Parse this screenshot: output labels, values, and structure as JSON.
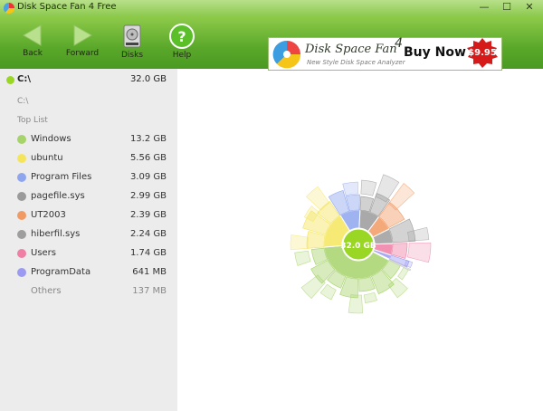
{
  "window": {
    "title": "Disk Space Fan 4 Free",
    "controls": {
      "minimize": "—",
      "maximize": "☐",
      "close": "✕"
    }
  },
  "toolbar": {
    "back_label": "Back",
    "forward_label": "Forward",
    "disks_label": "Disks",
    "help_label": "Help"
  },
  "ad": {
    "product": "Disk Space Fan",
    "version": "4",
    "tagline": "New Style Disk Space Analyzer",
    "cta": "Buy Now",
    "price": "$9.95"
  },
  "sidebar": {
    "drive": {
      "name": "C:\\",
      "size": "32.0 GB"
    },
    "path": "C:\\",
    "top_list_label": "Top List",
    "items": [
      {
        "name": "Windows",
        "size": "13.2 GB",
        "color": "#a6d36a"
      },
      {
        "name": "ubuntu",
        "size": "5.56 GB",
        "color": "#f4e55c"
      },
      {
        "name": "Program Files",
        "size": "3.09 GB",
        "color": "#8fa6ef"
      },
      {
        "name": "pagefile.sys",
        "size": "2.99 GB",
        "color": "#9a9a9a"
      },
      {
        "name": "UT2003",
        "size": "2.39 GB",
        "color": "#f29a63"
      },
      {
        "name": "hiberfil.sys",
        "size": "2.24 GB",
        "color": "#9e9e9e"
      },
      {
        "name": "Users",
        "size": "1.74 GB",
        "color": "#ef7fa4"
      },
      {
        "name": "ProgramData",
        "size": "641 MB",
        "color": "#9a9af2"
      }
    ],
    "others": {
      "name": "Others",
      "size": "137 MB"
    }
  },
  "chart_data": {
    "type": "pie",
    "center_label": "32.0 GB",
    "total_gb": 32.0,
    "slices": [
      {
        "name": "Windows",
        "value": 13.2,
        "color": "#a6d36a"
      },
      {
        "name": "ubuntu",
        "value": 5.56,
        "color": "#f4e55c"
      },
      {
        "name": "Program Files",
        "value": 3.09,
        "color": "#8fa6ef"
      },
      {
        "name": "pagefile.sys",
        "value": 2.99,
        "color": "#9a9a9a"
      },
      {
        "name": "UT2003",
        "value": 2.39,
        "color": "#f29a63"
      },
      {
        "name": "hiberfil.sys",
        "value": 2.24,
        "color": "#9e9e9e"
      },
      {
        "name": "Users",
        "value": 1.74,
        "color": "#ef7fa4"
      },
      {
        "name": "ProgramData",
        "value": 0.641,
        "color": "#9a9af2"
      },
      {
        "name": "Others",
        "value": 0.137,
        "color": "#cccccc"
      }
    ]
  }
}
